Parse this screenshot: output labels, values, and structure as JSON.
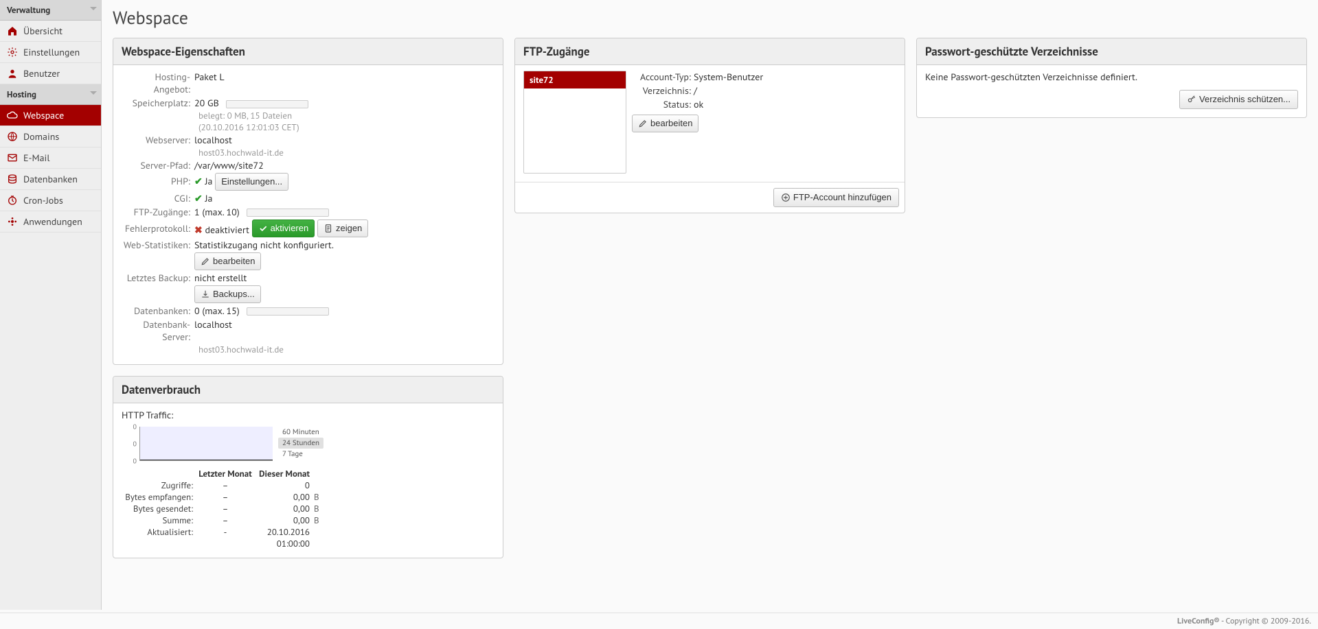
{
  "sidebar": {
    "verwaltung": "Verwaltung",
    "hosting": "Hosting",
    "items_mgmt": [
      {
        "label": "Übersicht"
      },
      {
        "label": "Einstellungen"
      },
      {
        "label": "Benutzer"
      }
    ],
    "items_host": [
      {
        "label": "Webspace"
      },
      {
        "label": "Domains"
      },
      {
        "label": "E-Mail"
      },
      {
        "label": "Datenbanken"
      },
      {
        "label": "Cron-Jobs"
      },
      {
        "label": "Anwendungen"
      }
    ]
  },
  "page_title": "Webspace",
  "props": {
    "title": "Webspace-Eigenschaften",
    "hosting_angebot": {
      "lbl": "Hosting-Angebot:",
      "val": "Paket L"
    },
    "speicher": {
      "lbl": "Speicherplatz:",
      "val": "20 GB",
      "sub1": "belegt: 0 MB, 15 Dateien",
      "sub2": "(20.10.2016 12:01:03 CET)"
    },
    "webserver": {
      "lbl": "Webserver:",
      "val": "localhost",
      "sub": "host03.hochwald-it.de"
    },
    "serverpfad": {
      "lbl": "Server-Pfad:",
      "val": "/var/www/site72"
    },
    "php": {
      "lbl": "PHP:",
      "val": "Ja",
      "btn": "Einstellungen..."
    },
    "cgi": {
      "lbl": "CGI:",
      "val": "Ja"
    },
    "ftp": {
      "lbl": "FTP-Zugänge:",
      "val": "1 (max. 10)"
    },
    "fehler": {
      "lbl": "Fehlerprotokoll:",
      "val": "deaktiviert",
      "btn_act": "aktivieren",
      "btn_show": "zeigen"
    },
    "stats": {
      "lbl": "Web-Statistiken:",
      "val": "Statistikzugang nicht konfiguriert.",
      "btn": "bearbeiten"
    },
    "backup": {
      "lbl": "Letztes Backup:",
      "val": "nicht erstellt",
      "btn": "Backups..."
    },
    "db": {
      "lbl": "Datenbanken:",
      "val": "0 (max. 15)"
    },
    "dbs": {
      "lbl": "Datenbank-Server:",
      "val": "localhost",
      "sub": "host03.hochwald-it.de"
    }
  },
  "ftp": {
    "title": "FTP-Zugänge",
    "name": "site72",
    "typ": {
      "lbl": "Account-Typ:",
      "val": "System-Benutzer"
    },
    "dir": {
      "lbl": "Verzeichnis:",
      "val": "/"
    },
    "status": {
      "lbl": "Status:",
      "val": "ok"
    },
    "btn_edit": "bearbeiten",
    "btn_add": "FTP-Account hinzufügen"
  },
  "pwdir": {
    "title": "Passwort-geschützte Verzeichnisse",
    "msg": "Keine Passwort-geschützten Verzeichnisse definiert.",
    "btn": "Verzeichnis schützen..."
  },
  "traffic": {
    "title": "Datenverbrauch",
    "subtitle": "HTTP Traffic:",
    "legend": [
      "60 Minuten",
      "24 Stunden",
      "7 Tage"
    ],
    "hdr": {
      "c2": "Letzter Monat",
      "c3": "Dieser Monat"
    },
    "rows": [
      {
        "lbl": "Zugriffe:",
        "a": "–",
        "b": "0",
        "u": ""
      },
      {
        "lbl": "Bytes empfangen:",
        "a": "–",
        "b": "0,00",
        "u": "B"
      },
      {
        "lbl": "Bytes gesendet:",
        "a": "–",
        "b": "0,00",
        "u": "B"
      },
      {
        "lbl": "Summe:",
        "a": "–",
        "b": "0,00",
        "u": "B"
      },
      {
        "lbl": "Aktualisiert:",
        "a": "-",
        "b": "20.10.2016",
        "u": ""
      }
    ],
    "updated_time": "01:00:00"
  },
  "chart_data": {
    "type": "line",
    "title": "HTTP Traffic",
    "xlabel": "",
    "ylabel": "",
    "ylim": [
      0,
      0
    ],
    "yticks": [
      0.0,
      0.0,
      0
    ],
    "series": [
      {
        "name": "7 Tage",
        "values": [
          0,
          0,
          0,
          0,
          0,
          0,
          0
        ]
      }
    ]
  },
  "footer": {
    "brand": "LiveConfig®",
    "rest": " - Copyright © 2009-2016."
  }
}
